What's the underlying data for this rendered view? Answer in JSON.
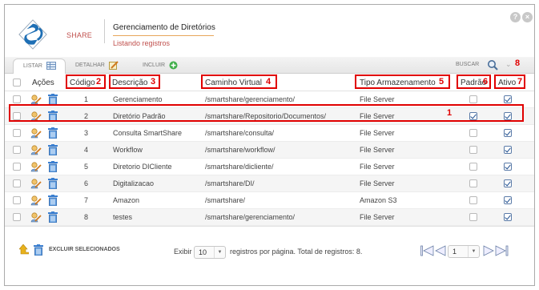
{
  "header": {
    "brand": "SHARE",
    "title": "Gerenciamento de Diretórios",
    "subtitle": "Listando registros",
    "help_icon": "help-icon",
    "close_icon": "close-icon"
  },
  "tabs": [
    {
      "label": "LISTAR",
      "icon": "list-icon"
    },
    {
      "label": "DETALHAR",
      "icon": "edit-icon"
    },
    {
      "label": "INCLUIR",
      "icon": "add-icon"
    }
  ],
  "search": {
    "label": "BUSCAR",
    "icon": "search-icon",
    "toggle_icon": "chevron-down-icon"
  },
  "columns": {
    "acoes": "Ações",
    "codigo": "Código",
    "descricao": "Descrição",
    "caminho": "Caminho Virtual",
    "tipo": "Tipo Armazenamento",
    "padrao": "Padrão",
    "ativo": "Ativo"
  },
  "rows": [
    {
      "codigo": "1",
      "descricao": "Gerenciamento",
      "caminho": "/smartshare/gerenciamento/",
      "tipo": "File Server",
      "padrao": false,
      "ativo": true
    },
    {
      "codigo": "2",
      "descricao": "Diretório Padrão",
      "caminho": "/smartshare/Repositorio/Documentos/",
      "tipo": "File Server",
      "padrao": true,
      "ativo": true
    },
    {
      "codigo": "3",
      "descricao": "Consulta SmartShare",
      "caminho": "/smartshare/consulta/",
      "tipo": "File Server",
      "padrao": false,
      "ativo": true
    },
    {
      "codigo": "4",
      "descricao": "Workflow",
      "caminho": "/smartshare/workflow/",
      "tipo": "File Server",
      "padrao": false,
      "ativo": true
    },
    {
      "codigo": "5",
      "descricao": "Diretorio DICliente",
      "caminho": "/smartshare/dicliente/",
      "tipo": "File Server",
      "padrao": false,
      "ativo": true
    },
    {
      "codigo": "6",
      "descricao": "Digitalizacao",
      "caminho": "/smartshare/DI/",
      "tipo": "File Server",
      "padrao": false,
      "ativo": true
    },
    {
      "codigo": "7",
      "descricao": "Amazon",
      "caminho": "/smartshare/",
      "tipo": "Amazon S3",
      "padrao": false,
      "ativo": true
    },
    {
      "codigo": "8",
      "descricao": "testes",
      "caminho": "/smartshare/gerenciamento/",
      "tipo": "File Server",
      "padrao": false,
      "ativo": true
    }
  ],
  "row_icons": {
    "edit": "edit-icon",
    "delete": "trash-icon"
  },
  "annotations": [
    "1",
    "2",
    "3",
    "4",
    "5",
    "6",
    "7",
    "8"
  ],
  "footer": {
    "delete_selected": "EXCLUIR SELECIONADOS",
    "exibir": "Exibir",
    "per_page": "10",
    "summary": "registros por página. Total de registros: 8.",
    "page": "1",
    "up_icon": "arrow-up-icon",
    "first_icon": "first-page-icon",
    "prev_icon": "prev-page-icon",
    "next_icon": "next-page-icon",
    "last_icon": "last-page-icon"
  },
  "colors": {
    "annotation": "#e00000",
    "brand": "#c0504d",
    "accent_line": "#e8a65a",
    "check": "#1f4f8f"
  }
}
